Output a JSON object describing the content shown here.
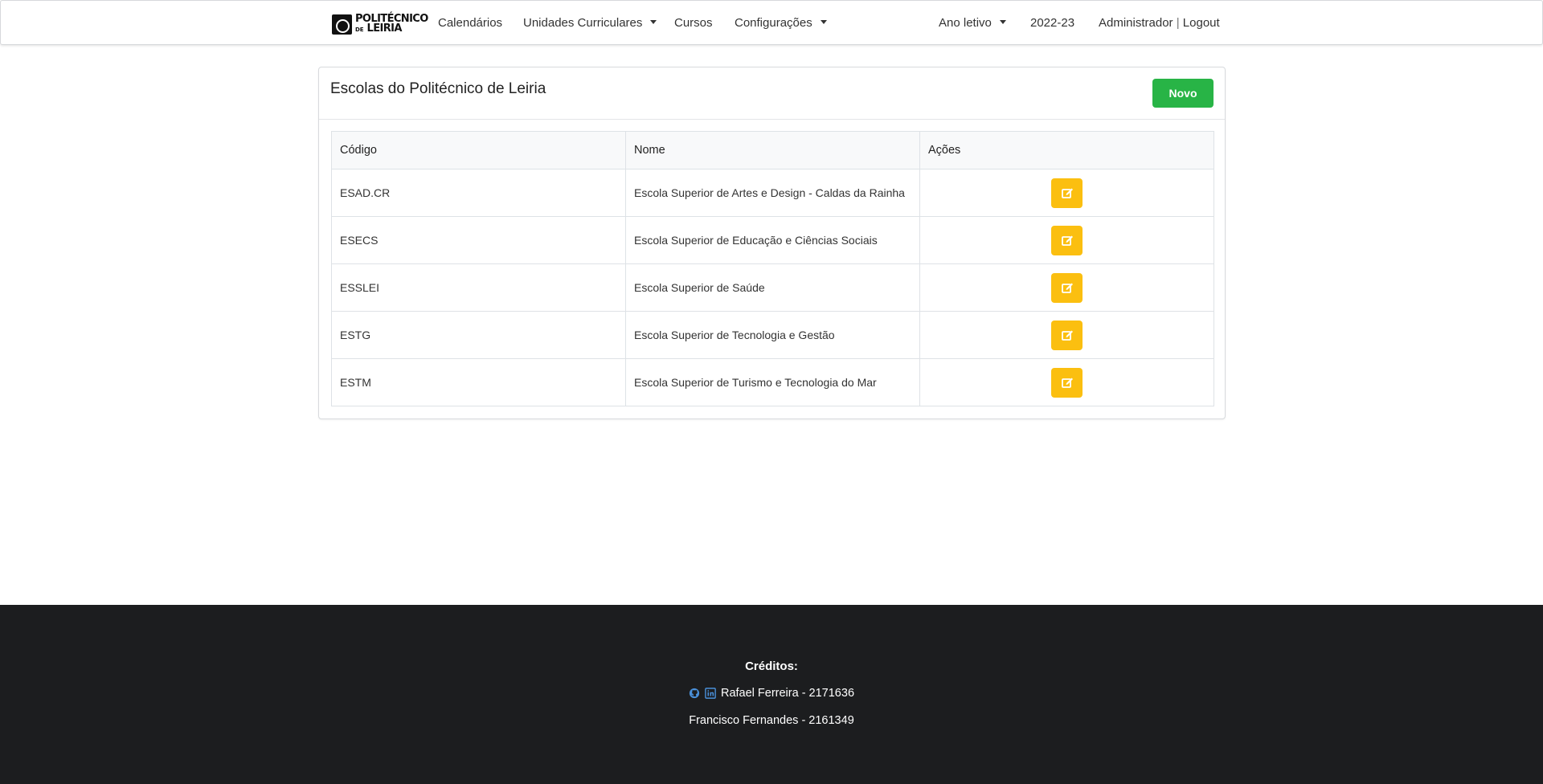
{
  "nav": {
    "brand_line1": "POLITÉCNICO",
    "brand_line2_small": "DE",
    "brand_line2": "LEIRIA",
    "calendarios": "Calendários",
    "unidades": "Unidades Curriculares",
    "cursos": "Cursos",
    "configuracoes": "Configurações",
    "ano_letivo": "Ano letivo",
    "ano_value": "2022-23",
    "user": "Administrador",
    "separator": "|",
    "logout": "Logout"
  },
  "card": {
    "title": "Escolas do Politécnico de Leiria",
    "new_button": "Novo"
  },
  "table": {
    "headers": [
      "Código",
      "Nome",
      "Ações"
    ],
    "rows": [
      {
        "codigo": "ESAD.CR",
        "nome": "Escola Superior de Artes e Design - Caldas da Rainha"
      },
      {
        "codigo": "ESECS",
        "nome": "Escola Superior de Educação e Ciências Sociais"
      },
      {
        "codigo": "ESSLEI",
        "nome": "Escola Superior de Saúde"
      },
      {
        "codigo": "ESTG",
        "nome": "Escola Superior de Tecnologia e Gestão"
      },
      {
        "codigo": "ESTM",
        "nome": "Escola Superior de Turismo e Tecnologia do Mar"
      }
    ]
  },
  "footer": {
    "title": "Créditos:",
    "credit1": "Rafael Ferreira - 2171636",
    "credit2": "Francisco Fernandes - 2161349",
    "icons": [
      "github-icon",
      "linkedin-icon"
    ]
  },
  "colors": {
    "new_button": "#28b446",
    "edit_button": "#fbbf10",
    "footer_bg": "#1c1d1f",
    "social_icon": "#4a90d9"
  }
}
